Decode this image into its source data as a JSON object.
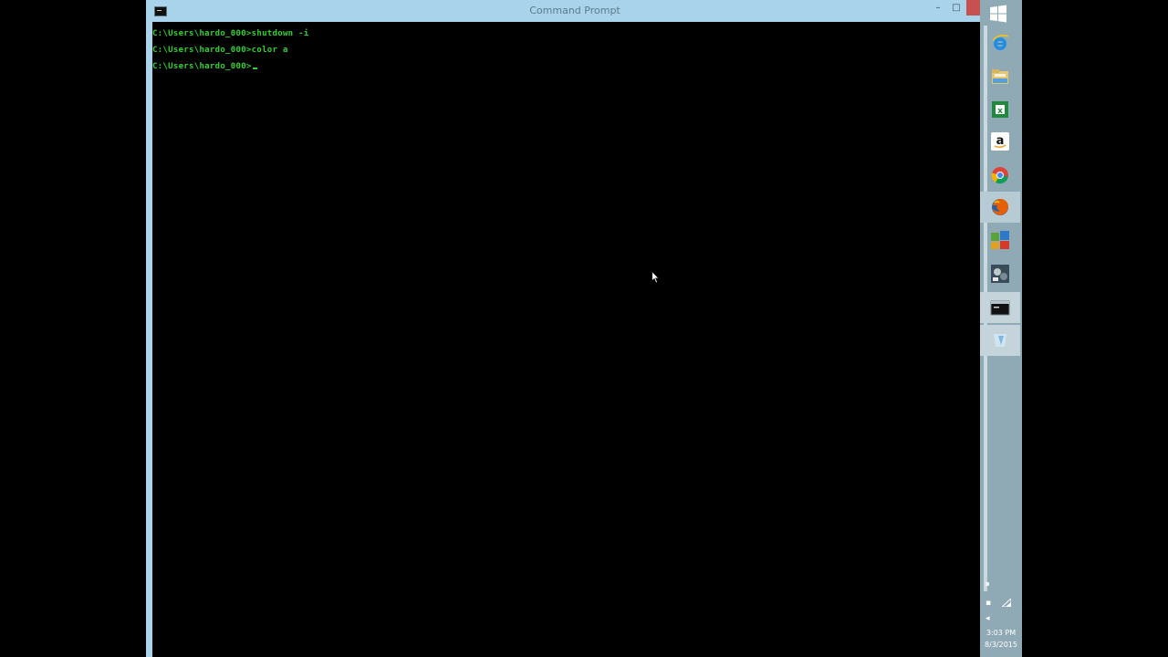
{
  "window": {
    "title": "Command Prompt",
    "minimize_glyph": "–",
    "maximize_glyph": "□",
    "close_glyph": "x"
  },
  "console": {
    "lines": [
      "C:\\Users\\hardo_000>shutdown -i",
      "C:\\Users\\hardo_000>color a",
      "C:\\Users\\hardo_000>"
    ],
    "text_color": "#2fd32f",
    "background_color": "#000000"
  },
  "taskbar": {
    "position": "right",
    "pinned": [
      {
        "name": "internet-explorer",
        "icon": "internet-explorer-icon"
      },
      {
        "name": "file-explorer",
        "icon": "folder-icon"
      },
      {
        "name": "excel",
        "icon": "excel-icon"
      },
      {
        "name": "amazon",
        "icon": "amazon-icon"
      },
      {
        "name": "chrome",
        "icon": "chrome-icon"
      },
      {
        "name": "firefox",
        "icon": "firefox-icon"
      },
      {
        "name": "app-collage",
        "icon": "collage-icon"
      },
      {
        "name": "media-app",
        "icon": "media-icon"
      },
      {
        "name": "command-prompt",
        "icon": "console-icon"
      },
      {
        "name": "app-blue",
        "icon": "blue-app-icon"
      }
    ],
    "clock": {
      "time": "3:03 PM",
      "date": "8/3/2015"
    }
  }
}
